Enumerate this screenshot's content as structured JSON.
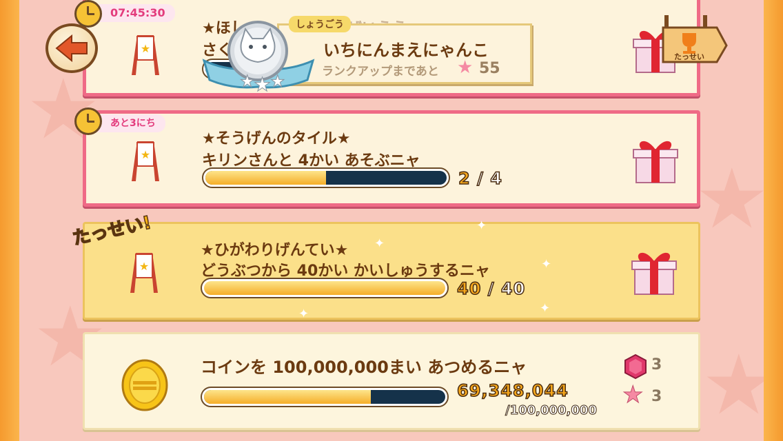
{
  "timer": "07:45:30",
  "rank_popup": {
    "label": "しょうごう",
    "title": "いちにんまえにゃんこ",
    "sub": "ランクアップまであと",
    "remaining": "55"
  },
  "achievement_button": {
    "label": "たっせい"
  },
  "missions": [
    {
      "tag": "",
      "title": "★ほし",
      "title_tail": "ぜいうう",
      "desc": "さく",
      "progress": null
    },
    {
      "tag": "あと3にち",
      "title": "★そうげんのタイル★",
      "desc": "キリンさんと 4かい あそぶニャ",
      "current": "2",
      "total": "4",
      "progress": 0.5
    },
    {
      "tag": "",
      "badge": "たっせい!",
      "title": "★ひがわりげんてい★",
      "desc": "どうぶつから 40かい かいしゅうするニャ",
      "current": "40",
      "total": "40",
      "progress": 1.0
    },
    {
      "title": "コインを 100,000,000まい あつめるニャ",
      "current": "69,348,044",
      "total": "/100,000,000",
      "progress": 0.69,
      "reward_gem": "3",
      "reward_star": "3"
    }
  ],
  "colors": {
    "pink_border": "#ef6a86",
    "gold_panel": "#fbe08a",
    "bar_fill": "#f5ae29",
    "bar_empty": "#15324a"
  },
  "icons": [
    "back-arrow-icon",
    "clock-icon",
    "easel-icon",
    "gift-icon",
    "trophy-icon",
    "cat-medal-icon",
    "coin-icon",
    "gem-icon",
    "star-icon",
    "sparkle-icon"
  ]
}
